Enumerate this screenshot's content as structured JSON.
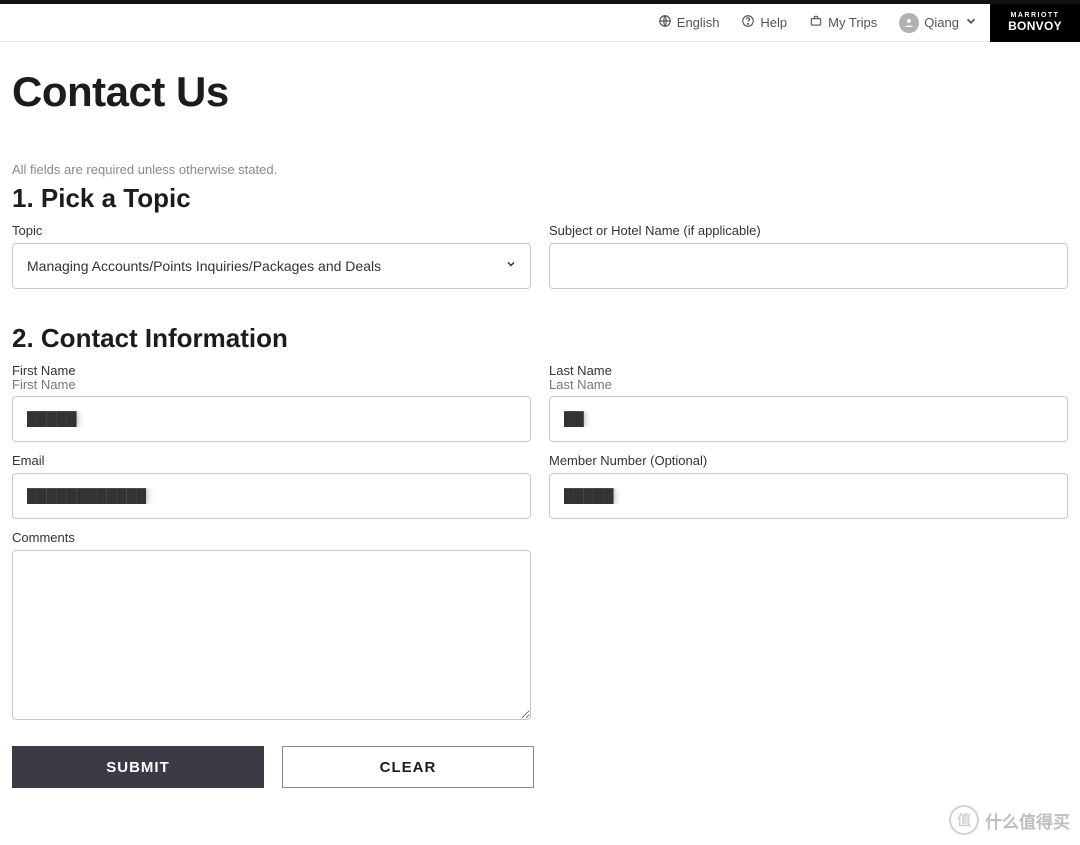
{
  "header": {
    "language": "English",
    "help": "Help",
    "mytrips": "My Trips",
    "user": "Qiang",
    "brand_small": "MARRIOTT",
    "brand_big": "BONVOY"
  },
  "page": {
    "title": "Contact Us",
    "hint": "All fields are required unless otherwise stated."
  },
  "section1": {
    "title": "1. Pick a Topic",
    "topic_label": "Topic",
    "topic_value": "Managing Accounts/Points Inquiries/Packages and Deals",
    "subject_label": "Subject or Hotel Name (if applicable)",
    "subject_value": ""
  },
  "section2": {
    "title": "2. Contact Information",
    "first_name_label": "First Name",
    "first_name_sub": "First Name",
    "first_name_value": "█████",
    "last_name_label": "Last Name",
    "last_name_sub": "Last Name",
    "last_name_value": "██",
    "email_label": "Email",
    "email_value": "████████████",
    "member_label": "Member Number (Optional)",
    "member_value": "█████",
    "comments_label": "Comments",
    "comments_value": ""
  },
  "buttons": {
    "submit": "SUBMIT",
    "clear": "CLEAR"
  },
  "watermark": "什么值得买"
}
